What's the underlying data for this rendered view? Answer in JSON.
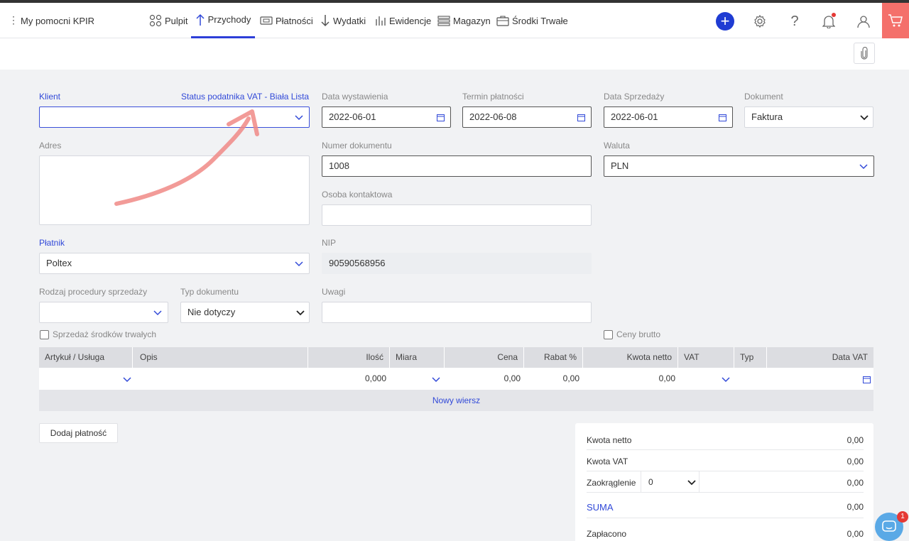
{
  "app": {
    "name": "My pomocni KPIR"
  },
  "nav": {
    "items": [
      {
        "label": "Pulpit",
        "icon": "dashboard-icon"
      },
      {
        "label": "Przychody",
        "icon": "arrow-up-icon",
        "active": true
      },
      {
        "label": "Płatności",
        "icon": "payment-icon"
      },
      {
        "label": "Wydatki",
        "icon": "arrow-down-icon"
      },
      {
        "label": "Ewidencje",
        "icon": "bars-icon"
      },
      {
        "label": "Magazyn",
        "icon": "warehouse-icon"
      },
      {
        "label": "Środki Trwałe",
        "icon": "briefcase-icon"
      }
    ],
    "accent": "#1f3cd3",
    "cart_color": "#f4706b"
  },
  "form": {
    "klient": {
      "label": "Klient",
      "value": ""
    },
    "status_vat": {
      "label": "Status podatnika VAT - Biała Lista"
    },
    "data_wystawienia": {
      "label": "Data wystawienia",
      "value": "2022-06-01"
    },
    "termin_platnosci": {
      "label": "Termin płatności",
      "value": "2022-06-08"
    },
    "data_sprzedazy": {
      "label": "Data Sprzedaży",
      "value": "2022-06-01"
    },
    "dokument": {
      "label": "Dokument",
      "value": "Faktura"
    },
    "adres": {
      "label": "Adres",
      "value": ""
    },
    "numer_dokumentu": {
      "label": "Numer dokumentu",
      "value": "1008"
    },
    "waluta": {
      "label": "Waluta",
      "value": "PLN"
    },
    "osoba_kontaktowa": {
      "label": "Osoba kontaktowa",
      "value": ""
    },
    "platnik": {
      "label": "Płatnik",
      "value": "Poltex"
    },
    "nip": {
      "label": "NIP",
      "value": "90590568956"
    },
    "rodzaj_procedury": {
      "label": "Rodzaj procedury sprzedaży",
      "value": ""
    },
    "typ_dokumentu": {
      "label": "Typ dokumentu",
      "value": "Nie dotyczy"
    },
    "uwagi": {
      "label": "Uwagi",
      "value": ""
    },
    "sprzedaz_srodkow": {
      "label": "Sprzedaż środków trwałych"
    },
    "ceny_brutto": {
      "label": "Ceny brutto"
    }
  },
  "table": {
    "headers": {
      "artykul": "Artykuł / Usługa",
      "opis": "Opis",
      "ilosc": "Ilość",
      "miara": "Miara",
      "cena": "Cena",
      "rabat": "Rabat %",
      "kwota_netto": "Kwota netto",
      "vat": "VAT",
      "typ": "Typ",
      "data_vat": "Data VAT"
    },
    "row": {
      "ilosc": "0,000",
      "cena": "0,00",
      "rabat": "0,00",
      "kwota_netto": "0,00"
    },
    "new_row": "Nowy wiersz"
  },
  "buttons": {
    "dodaj_platnosc": "Dodaj płatność"
  },
  "summary": {
    "kwota_netto": {
      "label": "Kwota netto",
      "value": "0,00"
    },
    "kwota_vat": {
      "label": "Kwota VAT",
      "value": "0,00"
    },
    "zaokraglenie": {
      "label": "Zaokrąglenie",
      "select": "0",
      "value": "0,00"
    },
    "suma": {
      "label": "SUMA",
      "value": "0,00"
    },
    "zaplacono": {
      "label": "Zapłacono",
      "value": "0,00"
    }
  },
  "chat": {
    "badge": "1"
  }
}
